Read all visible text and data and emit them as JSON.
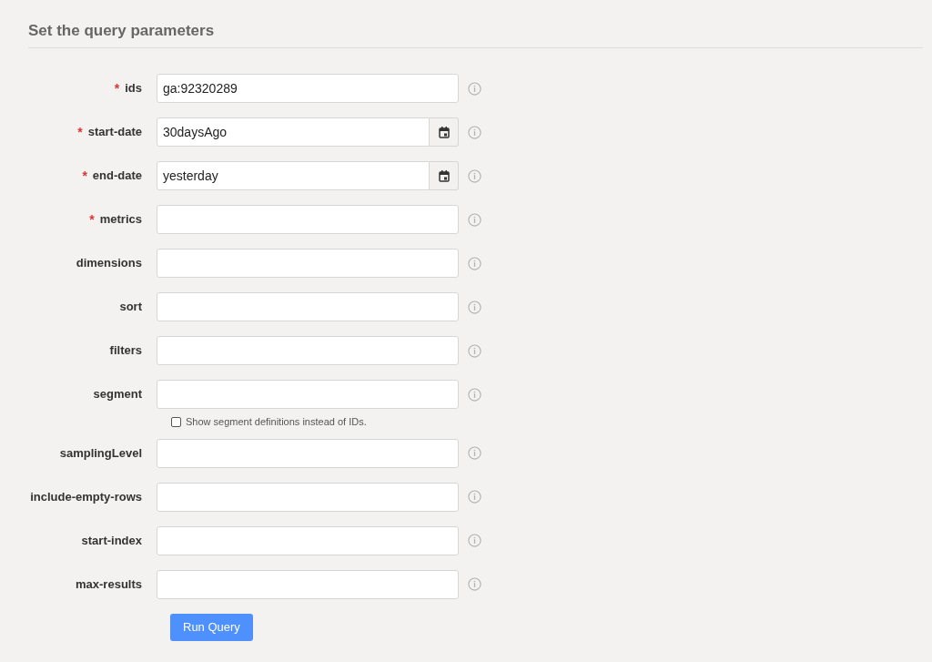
{
  "heading": "Set the query parameters",
  "fields": [
    {
      "label": "ids",
      "required": true,
      "kind": "text",
      "value": "ga:92320289"
    },
    {
      "label": "start-date",
      "required": true,
      "kind": "date",
      "value": "30daysAgo"
    },
    {
      "label": "end-date",
      "required": true,
      "kind": "date",
      "value": "yesterday"
    },
    {
      "label": "metrics",
      "required": true,
      "kind": "text"
    },
    {
      "label": "dimensions",
      "required": false,
      "kind": "text"
    },
    {
      "label": "sort",
      "required": false,
      "kind": "text"
    },
    {
      "label": "filters",
      "required": false,
      "kind": "text"
    },
    {
      "label": "segment",
      "required": false,
      "kind": "text",
      "option": {
        "label": "Show segment definitions instead of IDs.",
        "checked": false
      }
    },
    {
      "label": "samplingLevel",
      "required": false,
      "kind": "text"
    },
    {
      "label": "include-empty-rows",
      "required": false,
      "kind": "text"
    },
    {
      "label": "start-index",
      "required": false,
      "kind": "text"
    },
    {
      "label": "max-results",
      "required": false,
      "kind": "text"
    }
  ],
  "required_mark": "*",
  "submit": "Run Query"
}
